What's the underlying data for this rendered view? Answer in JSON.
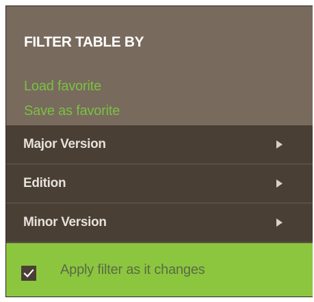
{
  "panel": {
    "title": "FILTER TABLE BY",
    "links": {
      "load_favorite": "Load favorite",
      "save_favorite": "Save as favorite"
    },
    "filters": [
      {
        "label": "Major Version",
        "icon": "chevron-right-icon"
      },
      {
        "label": "Edition",
        "icon": "chevron-right-icon"
      },
      {
        "label": "Minor Version",
        "icon": "chevron-right-icon"
      }
    ],
    "apply_checkbox": {
      "label": "Apply filter as it changes",
      "checked": true
    }
  },
  "colors": {
    "header_bg": "#786a5d",
    "rows_bg": "#4a3f35",
    "link_green": "#7bc143",
    "footer_green": "#8cc63f"
  }
}
